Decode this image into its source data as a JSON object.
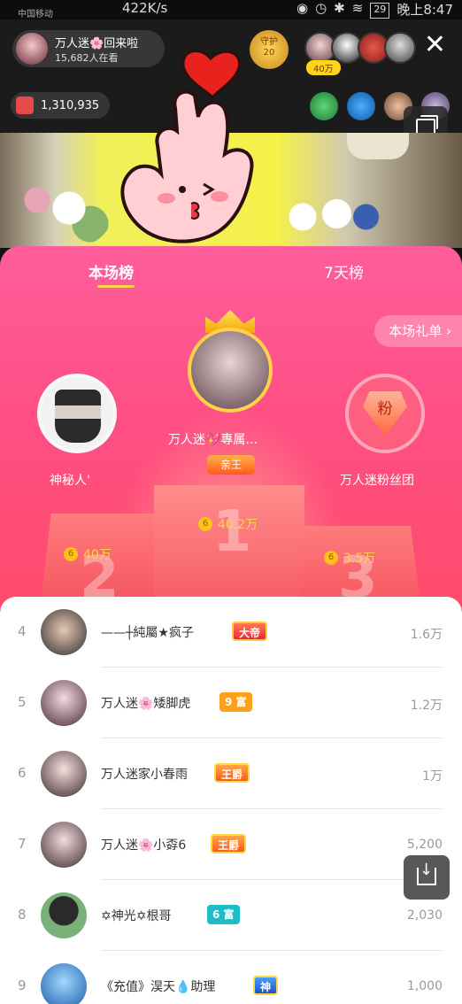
{
  "status_bar": {
    "carrier": "中国移动",
    "network_speed": "422K/s",
    "battery": "29",
    "time": "晚上8:47"
  },
  "live": {
    "host_name": "万人迷🌸回来啦",
    "viewers": "15,682人在看",
    "guard_label": "守护",
    "guard_count": "20",
    "fan_amount": "40万",
    "coins": "1,310,935"
  },
  "panel": {
    "tab_current": "本场榜",
    "tab_week": "7天榜",
    "gift_list_button": "本场礼单"
  },
  "podium": [
    {
      "rank": "2",
      "name": "神秘人'",
      "score": "40万"
    },
    {
      "rank": "1",
      "name": "万人迷💖專属…",
      "badge": "亲王",
      "score": "40.2万"
    },
    {
      "rank": "3",
      "name": "万人迷粉丝团",
      "icon_label": "粉",
      "score": "3.5万"
    }
  ],
  "list": [
    {
      "rank": "4",
      "name": "——┼純屬★疯子",
      "badge": "大帝",
      "value": "1.6万"
    },
    {
      "rank": "5",
      "name": "万人迷🌸矮脚虎",
      "badge": "9 富",
      "value": "1.2万"
    },
    {
      "rank": "6",
      "name": "万人迷家小春雨",
      "badge": "王爵",
      "value": "1万"
    },
    {
      "rank": "7",
      "name": "万人迷🌸小孬6",
      "badge": "王爵",
      "value": "5,200"
    },
    {
      "rank": "8",
      "name": "✡神光✡根哥",
      "badge": "6 富",
      "value": "2,030"
    },
    {
      "rank": "9",
      "name": "《充值》淏天💧助理",
      "badge": "神",
      "value": "1,000"
    }
  ]
}
